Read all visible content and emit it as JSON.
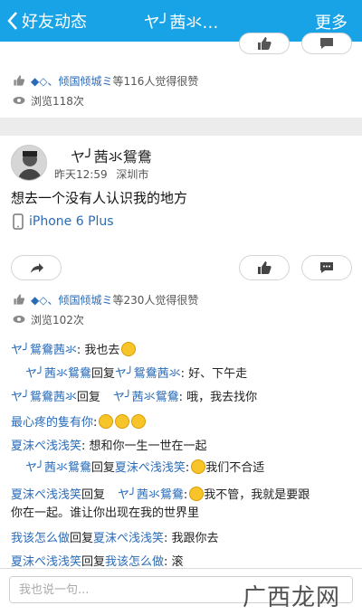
{
  "header": {
    "back_label": "好友动态",
    "title": "ヤ╯茜氺…",
    "more_label": "更多"
  },
  "card1": {
    "likes_text": "等116人觉得很赞",
    "likes_name": "◆◇、倾国倾城ミ",
    "views_text": "浏览118次"
  },
  "card2": {
    "user_name": "ヤ╯茜氺鴛鴦",
    "time": "昨天12:59",
    "location": "深圳市",
    "post_text": "想去一个没有人认识我的地方",
    "device": "iPhone 6 Plus",
    "likes_name": "◆◇、倾国倾城ミ",
    "likes_text": "等230人觉得很赞",
    "views_text": "浏览102次"
  },
  "comments": [
    {
      "p1": "ヤ╯鴛鴦茜氺",
      "p2": ": 我也去",
      "emoji": 1
    },
    {
      "p1": "ヤ╯茜氺鴛鴦",
      "p2": "回复",
      "p3": "ヤ╯鴛鴦茜氺",
      "p4": ": 好、下午走"
    },
    {
      "p1": "ヤ╯鴛鴦茜氺",
      "p2": "回复",
      "p3": "ヤ╯茜氺鴛鴦",
      "p4": ": 哦，我去找你"
    },
    {
      "p1": "最心疼的隻有你",
      "p2": ":",
      "emoji": 3
    },
    {
      "p1": "夏沫ぺ浅浅笑",
      "p2": ": 想和你一生一世在一起"
    },
    {
      "p1": "ヤ╯茜氺鴛鴦",
      "p2": "回复",
      "p3": "夏沫ぺ浅浅笑",
      "p4": ":",
      "p5": "我们不合适",
      "emoji": 1
    },
    {
      "p1": "夏沫ぺ浅浅笑",
      "p2": "回复",
      "p3": "ヤ╯茜氺鴛鴦",
      "p4": ":",
      "p5": "我不管，我就是要跟",
      "emoji": 1,
      "line2": "你在一起。谁让你出现在我的世界里"
    },
    {
      "p1": "我该怎么做",
      "p2": "回复",
      "p3": "夏沫ぺ浅浅笑",
      "p4": ": 我跟你去"
    },
    {
      "p1": "夏沫ぺ浅浅笑",
      "p2": "回复",
      "p3": "我该怎么做",
      "p4": ": 滚"
    }
  ],
  "input": {
    "placeholder": "我也说一句..."
  },
  "watermark": "广西龙网",
  "colors": {
    "header": "#17a3e6",
    "link": "#2a6bb8"
  }
}
